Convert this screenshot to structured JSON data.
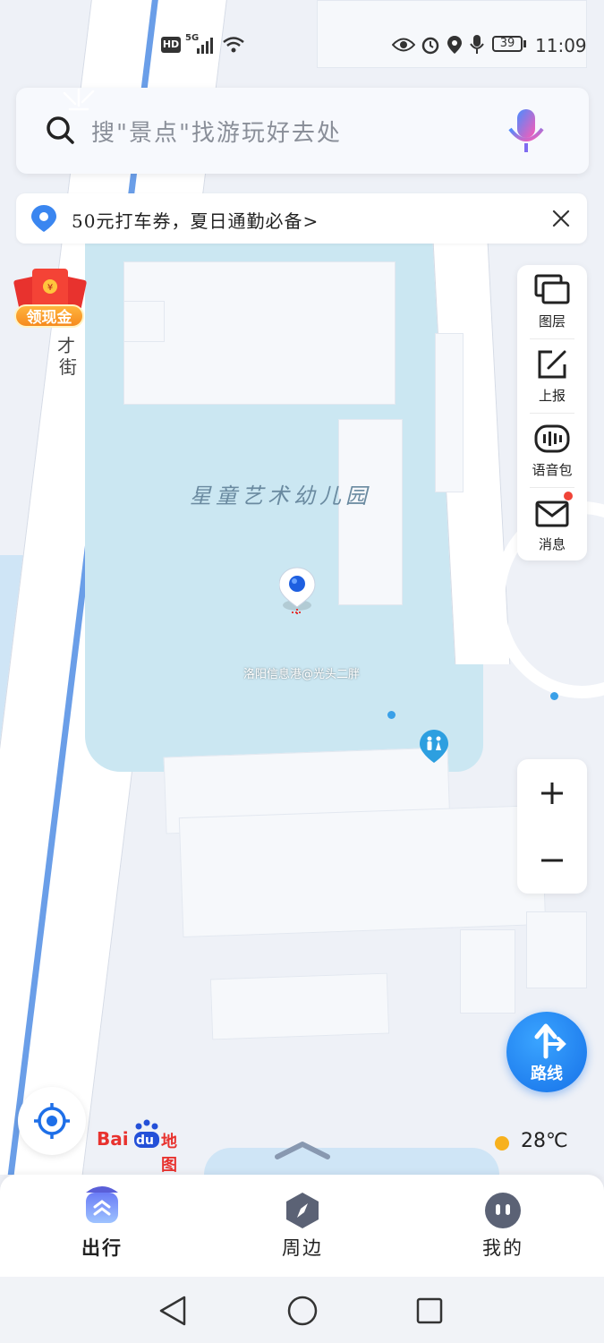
{
  "status_bar": {
    "hd": "HD",
    "network": "5G",
    "battery": "39",
    "time": "11:09"
  },
  "search": {
    "placeholder": "搜\"景点\"找游玩好去处"
  },
  "banner": {
    "text": "50元打车券，夏日通勤必备>"
  },
  "map": {
    "street_label_1": "才",
    "street_label_2": "街",
    "poi_name": "星童艺术幼儿园",
    "watermark": "洛阳信息港@光头二胖",
    "temperature": "28℃",
    "logo_text_bai": "Bai",
    "logo_text_du": "du",
    "logo_text_ditu": "地图",
    "red_packet_label": "领现金"
  },
  "tools": [
    {
      "label": "图层",
      "icon": "layers-icon"
    },
    {
      "label": "上报",
      "icon": "report-icon"
    },
    {
      "label": "语音包",
      "icon": "voice-pack-icon"
    },
    {
      "label": "消息",
      "icon": "message-icon"
    }
  ],
  "route": {
    "label": "路线"
  },
  "bottom_nav": [
    {
      "label": "出行",
      "icon": "travel-icon"
    },
    {
      "label": "周边",
      "icon": "compass-icon"
    },
    {
      "label": "我的",
      "icon": "profile-icon"
    }
  ],
  "colors": {
    "accent": "#1671e8",
    "park": "#cbe7f2",
    "road": "#6a9ee8"
  }
}
